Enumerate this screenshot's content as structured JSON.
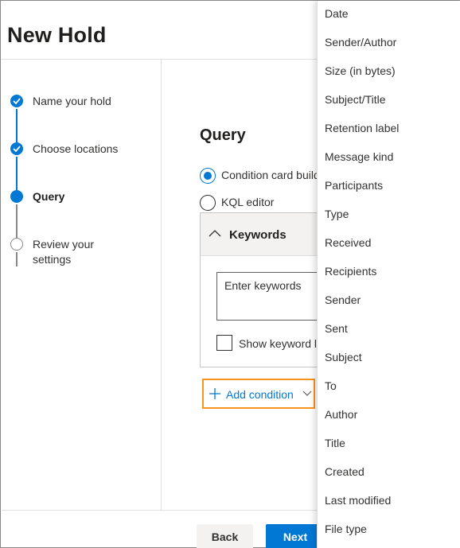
{
  "page": {
    "title": "New Hold"
  },
  "steps": [
    {
      "label_lines": [
        "Name your hold"
      ],
      "state": "done"
    },
    {
      "label_lines": [
        "Choose locations"
      ],
      "state": "done"
    },
    {
      "label_lines": [
        "Query"
      ],
      "state": "current"
    },
    {
      "label_lines": [
        "Review your",
        "settings"
      ],
      "state": "todo"
    }
  ],
  "main": {
    "section_title": "Query",
    "radio_options": [
      {
        "label": "Condition card build",
        "checked": true
      },
      {
        "label": "KQL editor",
        "checked": false
      }
    ],
    "card": {
      "title": "Keywords",
      "keywords_placeholder": "Enter keywords",
      "checkbox_label": "Show keyword li"
    },
    "add_condition": {
      "label": "Add condition"
    }
  },
  "footer": {
    "back_label": "Back",
    "next_label": "Next"
  },
  "dropdown": {
    "items": [
      "Date",
      "Sender/Author",
      "Size (in bytes)",
      "Subject/Title",
      "Retention label",
      "Message kind",
      "Participants",
      "Type",
      "Received",
      "Recipients",
      "Sender",
      "Sent",
      "Subject",
      "To",
      "Author",
      "Title",
      "Created",
      "Last modified",
      "File type"
    ]
  },
  "colors": {
    "accent": "#0078d4",
    "highlight": "#f7941d",
    "text": "#323130"
  }
}
